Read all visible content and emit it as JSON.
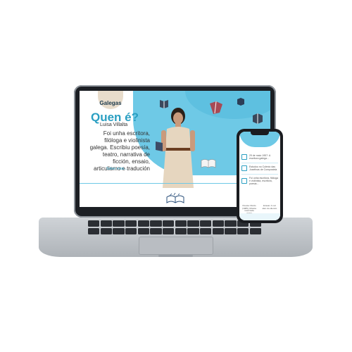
{
  "laptop": {
    "logo": "Galegas",
    "hero": {
      "title": "Quen é?",
      "subtitle": "Luisa Villalta",
      "text": "Foi unha escritora, filóloga e violinista galega. Escribiu poesía, teatro, narrativa de ficción, ensaio, articulismo e tradución",
      "link": "Saber máis..."
    }
  },
  "phone": {
    "rows": [
      {
        "text": "29 de maio 1957: A escritora galega..."
      },
      {
        "text": "Estudou no Colexio das Josefinas de Compostela"
      },
      {
        "text": "Foi unha escritora, filóloga e violinista, escritora, poesía..."
      }
    ],
    "columns": [
      {
        "text": "Poesía: Ruído (1985), Música reservada (1991)"
      },
      {
        "text": "Ensaio: A voz alén do silencio"
      }
    ]
  },
  "colors": {
    "accent": "#2a9fc2",
    "blob": "#6ec9e6",
    "device_dark": "#1c1f24",
    "aluminium": "#c3c7cb"
  }
}
